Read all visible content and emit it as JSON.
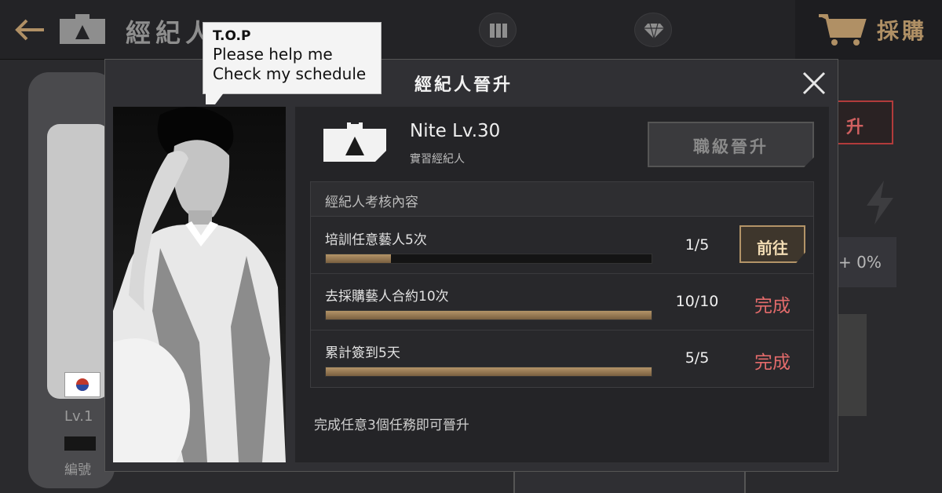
{
  "topbar": {
    "title": "經紀人",
    "buy_label": "採購",
    "icons": [
      "back-arrow-icon",
      "camera-icon",
      "book-icon",
      "diamond-icon",
      "cart-icon"
    ]
  },
  "background": {
    "level_label": "Lv.1",
    "serial_label": "編號",
    "promote_text": "升",
    "stat_text": "+ 0%"
  },
  "modal": {
    "title": "經紀人晉升",
    "speech": {
      "name": "T.O.P",
      "lines": [
        "Please help me",
        "Check my schedule"
      ]
    },
    "manager": {
      "name_level": "Nite Lv.30",
      "rank": "實習經紀人"
    },
    "rank_button": "職級晉升",
    "task_header": "經紀人考核內容",
    "tasks": [
      {
        "label": "培訓任意藝人5次",
        "count": "1/5",
        "progress": 0.2,
        "action": "前往"
      },
      {
        "label": "去採購藝人合約10次",
        "count": "10/10",
        "progress": 1.0,
        "action": "完成"
      },
      {
        "label": "累計簽到5天",
        "count": "5/5",
        "progress": 1.0,
        "action": "完成"
      }
    ],
    "footer": "完成任意3個任務即可晉升"
  },
  "colors": {
    "accent_gold": "#b39468",
    "done_red": "#e36b6b",
    "panel_dark": "#242427"
  }
}
